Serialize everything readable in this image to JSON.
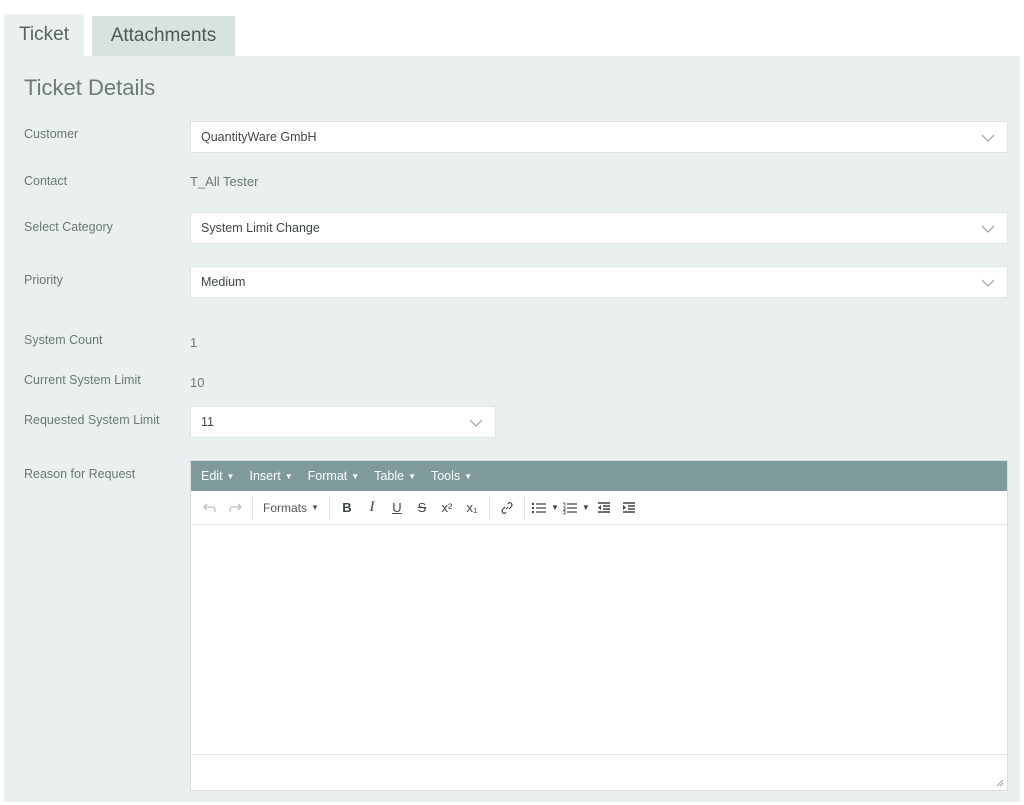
{
  "tabs": [
    {
      "label": "Ticket",
      "active": true
    },
    {
      "label": "Attachments",
      "active": false
    }
  ],
  "section_title": "Ticket Details",
  "form": {
    "customer": {
      "label": "Customer",
      "value": "QuantityWare GmbH"
    },
    "contact": {
      "label": "Contact",
      "value": "T_All Tester"
    },
    "category": {
      "label": "Select Category",
      "value": "System Limit Change"
    },
    "priority": {
      "label": "Priority",
      "value": "Medium"
    },
    "system_count": {
      "label": "System Count",
      "value": "1"
    },
    "current_limit": {
      "label": "Current System Limit",
      "value": "10"
    },
    "requested_limit": {
      "label": "Requested System Limit",
      "value": "11"
    },
    "reason": {
      "label": "Reason for Request",
      "value": ""
    }
  },
  "editor": {
    "menus": [
      "Edit",
      "Insert",
      "Format",
      "Table",
      "Tools"
    ],
    "formats_label": "Formats",
    "toolbar_icons": [
      "undo-icon",
      "redo-icon",
      "bold-icon",
      "italic-icon",
      "underline-icon",
      "strikethrough-icon",
      "superscript-icon",
      "subscript-icon",
      "link-icon",
      "bullet-list-icon",
      "numbered-list-icon",
      "outdent-icon",
      "indent-icon"
    ]
  },
  "colors": {
    "panel_bg": "#e9f0ef",
    "menubar_bg": "#7e9a9b",
    "inactive_tab_bg": "#d7e3e1"
  }
}
